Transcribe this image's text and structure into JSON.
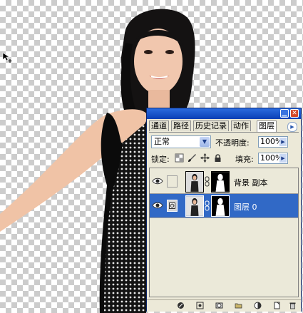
{
  "tabs": [
    {
      "label": "通道",
      "active": false
    },
    {
      "label": "路径",
      "active": false
    },
    {
      "label": "历史记录",
      "active": false
    },
    {
      "label": "动作",
      "active": false
    },
    {
      "label": "图层",
      "active": true
    }
  ],
  "blend": {
    "mode": "正常",
    "opacity_label": "不透明度:",
    "opacity_value": "100%"
  },
  "lock": {
    "label": "锁定:",
    "fill_label": "填充:",
    "fill_value": "100%"
  },
  "layers": [
    {
      "name": "背景 副本",
      "visible": true,
      "selected": false
    },
    {
      "name": "图层 0",
      "visible": true,
      "selected": true
    }
  ],
  "colors": {
    "accent": "#3169c6",
    "titlebar": "#0a3fb5",
    "panel_bg": "#ece9d8"
  }
}
